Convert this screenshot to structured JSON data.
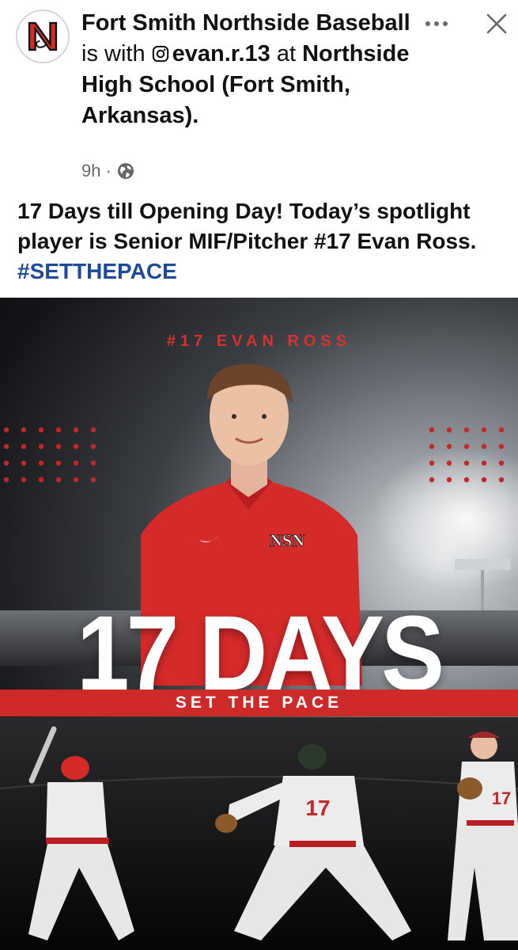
{
  "post": {
    "page_name": "Fort Smith Northside Baseball",
    "with_text": " is with ",
    "tagged_user": "evan.r.13",
    "at_text": " at ",
    "location": "Northside High School (Fort Smith, Arkansas)",
    "end_punct": ".",
    "time": "9h",
    "separator": "·",
    "privacy_icon": "globe-icon",
    "more_icon": "more-horizontal-icon",
    "close_icon": "close-icon"
  },
  "caption": {
    "text": "17 Days till Opening Day! Today’s spotlight player is Senior MIF/Pitcher #17 Evan Ross. ",
    "hashtag": "#SETTHEPACE"
  },
  "graphic": {
    "player_name": "#17 EVAN ROSS",
    "headline": "17 DAYS",
    "band_text": "SET THE PACE",
    "jersey_number": "17",
    "logo_letters": "NSN",
    "colors": {
      "accent_red": "#cf2a2a",
      "name_red": "#d9312d",
      "link_blue": "#1e4a9a"
    }
  }
}
